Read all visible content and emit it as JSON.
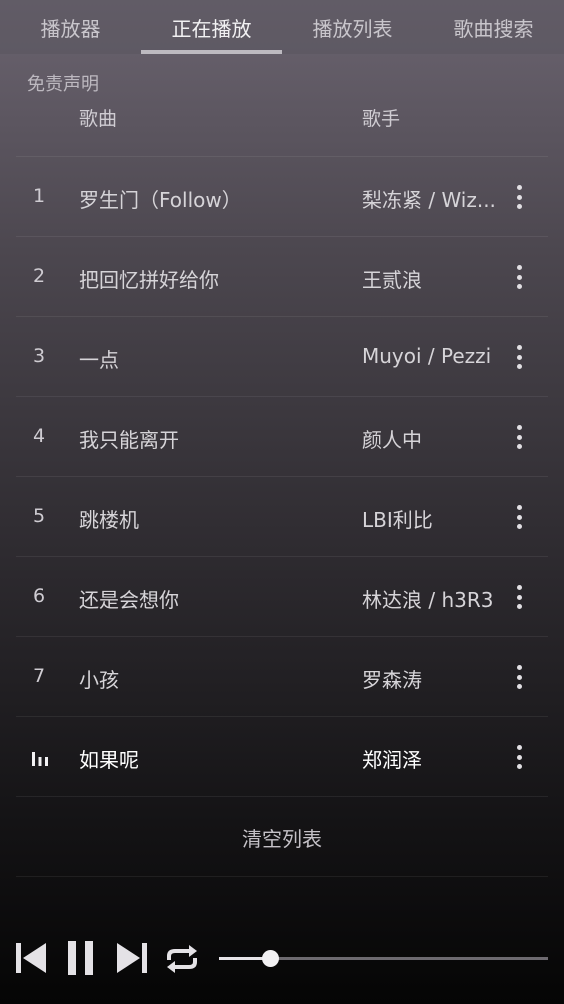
{
  "tabs": [
    {
      "label": "播放器",
      "active": false
    },
    {
      "label": "正在播放",
      "active": true
    },
    {
      "label": "播放列表",
      "active": false
    },
    {
      "label": "歌曲搜索",
      "active": false
    }
  ],
  "disclaimer": "免责声明",
  "header": {
    "song": "歌曲",
    "artist": "歌手"
  },
  "songs": [
    {
      "index": "1",
      "title": "罗生门（Follow）",
      "artist": "梨冻紧 / Wiz..."
    },
    {
      "index": "2",
      "title": "把回忆拼好给你",
      "artist": "王贰浪"
    },
    {
      "index": "3",
      "title": "一点",
      "artist": "Muyoi / Pezzi"
    },
    {
      "index": "4",
      "title": "我只能离开",
      "artist": "颜人中"
    },
    {
      "index": "5",
      "title": "跳楼机",
      "artist": "LBI利比"
    },
    {
      "index": "6",
      "title": "还是会想你",
      "artist": "林达浪 / h3R3"
    },
    {
      "index": "7",
      "title": "小孩",
      "artist": "罗森涛"
    },
    {
      "index": "",
      "title": "如果呢",
      "artist": "郑润泽",
      "playing": true
    }
  ],
  "clear_label": "清空列表",
  "player": {
    "icons": [
      "skip-previous-icon",
      "pause-icon",
      "skip-next-icon",
      "repeat-icon"
    ],
    "progress": 0.154
  },
  "colors": {
    "text": "#d6d4d8",
    "accent": "#f2f1f3",
    "track": "#6d6a70"
  }
}
